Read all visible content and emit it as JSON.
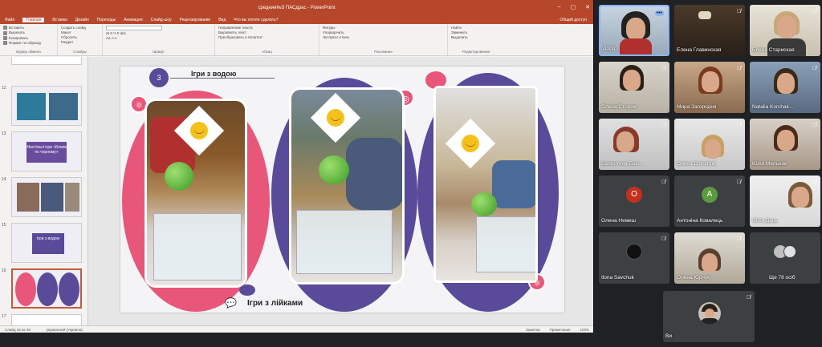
{
  "ppt": {
    "title": "средняя№3 ПАСдрас - PowerPoint",
    "menu": [
      "Файл",
      "Главная",
      "Вставка",
      "Дизайн",
      "Переходы",
      "Анимация",
      "Слайд-шоу",
      "Рецензирование",
      "Вид",
      "Что вы хотите сделать?"
    ],
    "active_menu": "Главная",
    "share": "Общий доступ",
    "ribbon_groups": [
      {
        "name": "Буфер обмена",
        "items": [
          "Вставить",
          "Вырезать",
          "Копировать",
          "Формат по образцу"
        ]
      },
      {
        "name": "Слайды",
        "items": [
          "Создать слайд",
          "Макет",
          "Сбросить",
          "Раздел"
        ]
      },
      {
        "name": "Шрифт",
        "items": [
          "Ж  К  Ч  S  abc",
          "Аа  A  A"
        ]
      },
      {
        "name": "Абзац",
        "items": [
          "Направление текста",
          "Выровнять текст",
          "Преобразовать в SmartArt"
        ]
      },
      {
        "name": "Рисование",
        "items": [
          "Фигуры",
          "Упорядочить",
          "Экспресс-стили"
        ]
      },
      {
        "name": "Редактирование",
        "items": [
          "Найти",
          "Заменить",
          "Выделить"
        ]
      }
    ],
    "status": {
      "slide": "Слайд 16 из 28",
      "lang": "украинский (Украина)",
      "notes": "Заметки",
      "comments": "Примечания",
      "zoom": "103%"
    }
  },
  "thumbs": [
    {
      "num": "",
      "label": ""
    },
    {
      "num": "12",
      "label": ""
    },
    {
      "num": "13",
      "label": "Настільні ігри «Білим по чорному»"
    },
    {
      "num": "14",
      "label": ""
    },
    {
      "num": "15",
      "label": "Ігри з водою"
    },
    {
      "num": "16",
      "label": ""
    },
    {
      "num": "17",
      "label": ""
    }
  ],
  "slide": {
    "number": "3",
    "heading": "Ігри з водою",
    "caption": "Ігри з лійками"
  },
  "participants": [
    {
      "name": "Дорд…",
      "type": "video",
      "muted": false,
      "more": true
    },
    {
      "name": "Елена Главинская",
      "type": "video",
      "muted": true
    },
    {
      "name": "Елена Стариская",
      "type": "video",
      "muted": true
    },
    {
      "name": "Олена Сторож",
      "type": "video",
      "muted": true
    },
    {
      "name": "Мира Загородня",
      "type": "video",
      "muted": true
    },
    {
      "name": "Natalia Korchak…",
      "type": "video",
      "muted": true
    },
    {
      "name": "Валентина Бозі…",
      "type": "video",
      "muted": true
    },
    {
      "name": "Олена Doinchuk",
      "type": "video",
      "muted": true
    },
    {
      "name": "Юлія Мельник",
      "type": "video",
      "muted": true
    },
    {
      "name": "Олена Немеш",
      "type": "avatar",
      "initial": "О",
      "color": "#c5301b",
      "muted": true
    },
    {
      "name": "Антоніна Ковалець",
      "type": "avatar",
      "initial": "А",
      "color": "#5b9a3f",
      "muted": true
    },
    {
      "name": "Юлія Дяць",
      "type": "video",
      "muted": true
    },
    {
      "name": "Ilona Savchuk",
      "type": "avatar-dark",
      "muted": true
    },
    {
      "name": "Олена Юрчук",
      "type": "video",
      "muted": true
    },
    {
      "name": "Ще 78 осіб",
      "type": "more",
      "muted": false
    },
    {
      "name": "Ви",
      "type": "video",
      "muted": true
    }
  ]
}
